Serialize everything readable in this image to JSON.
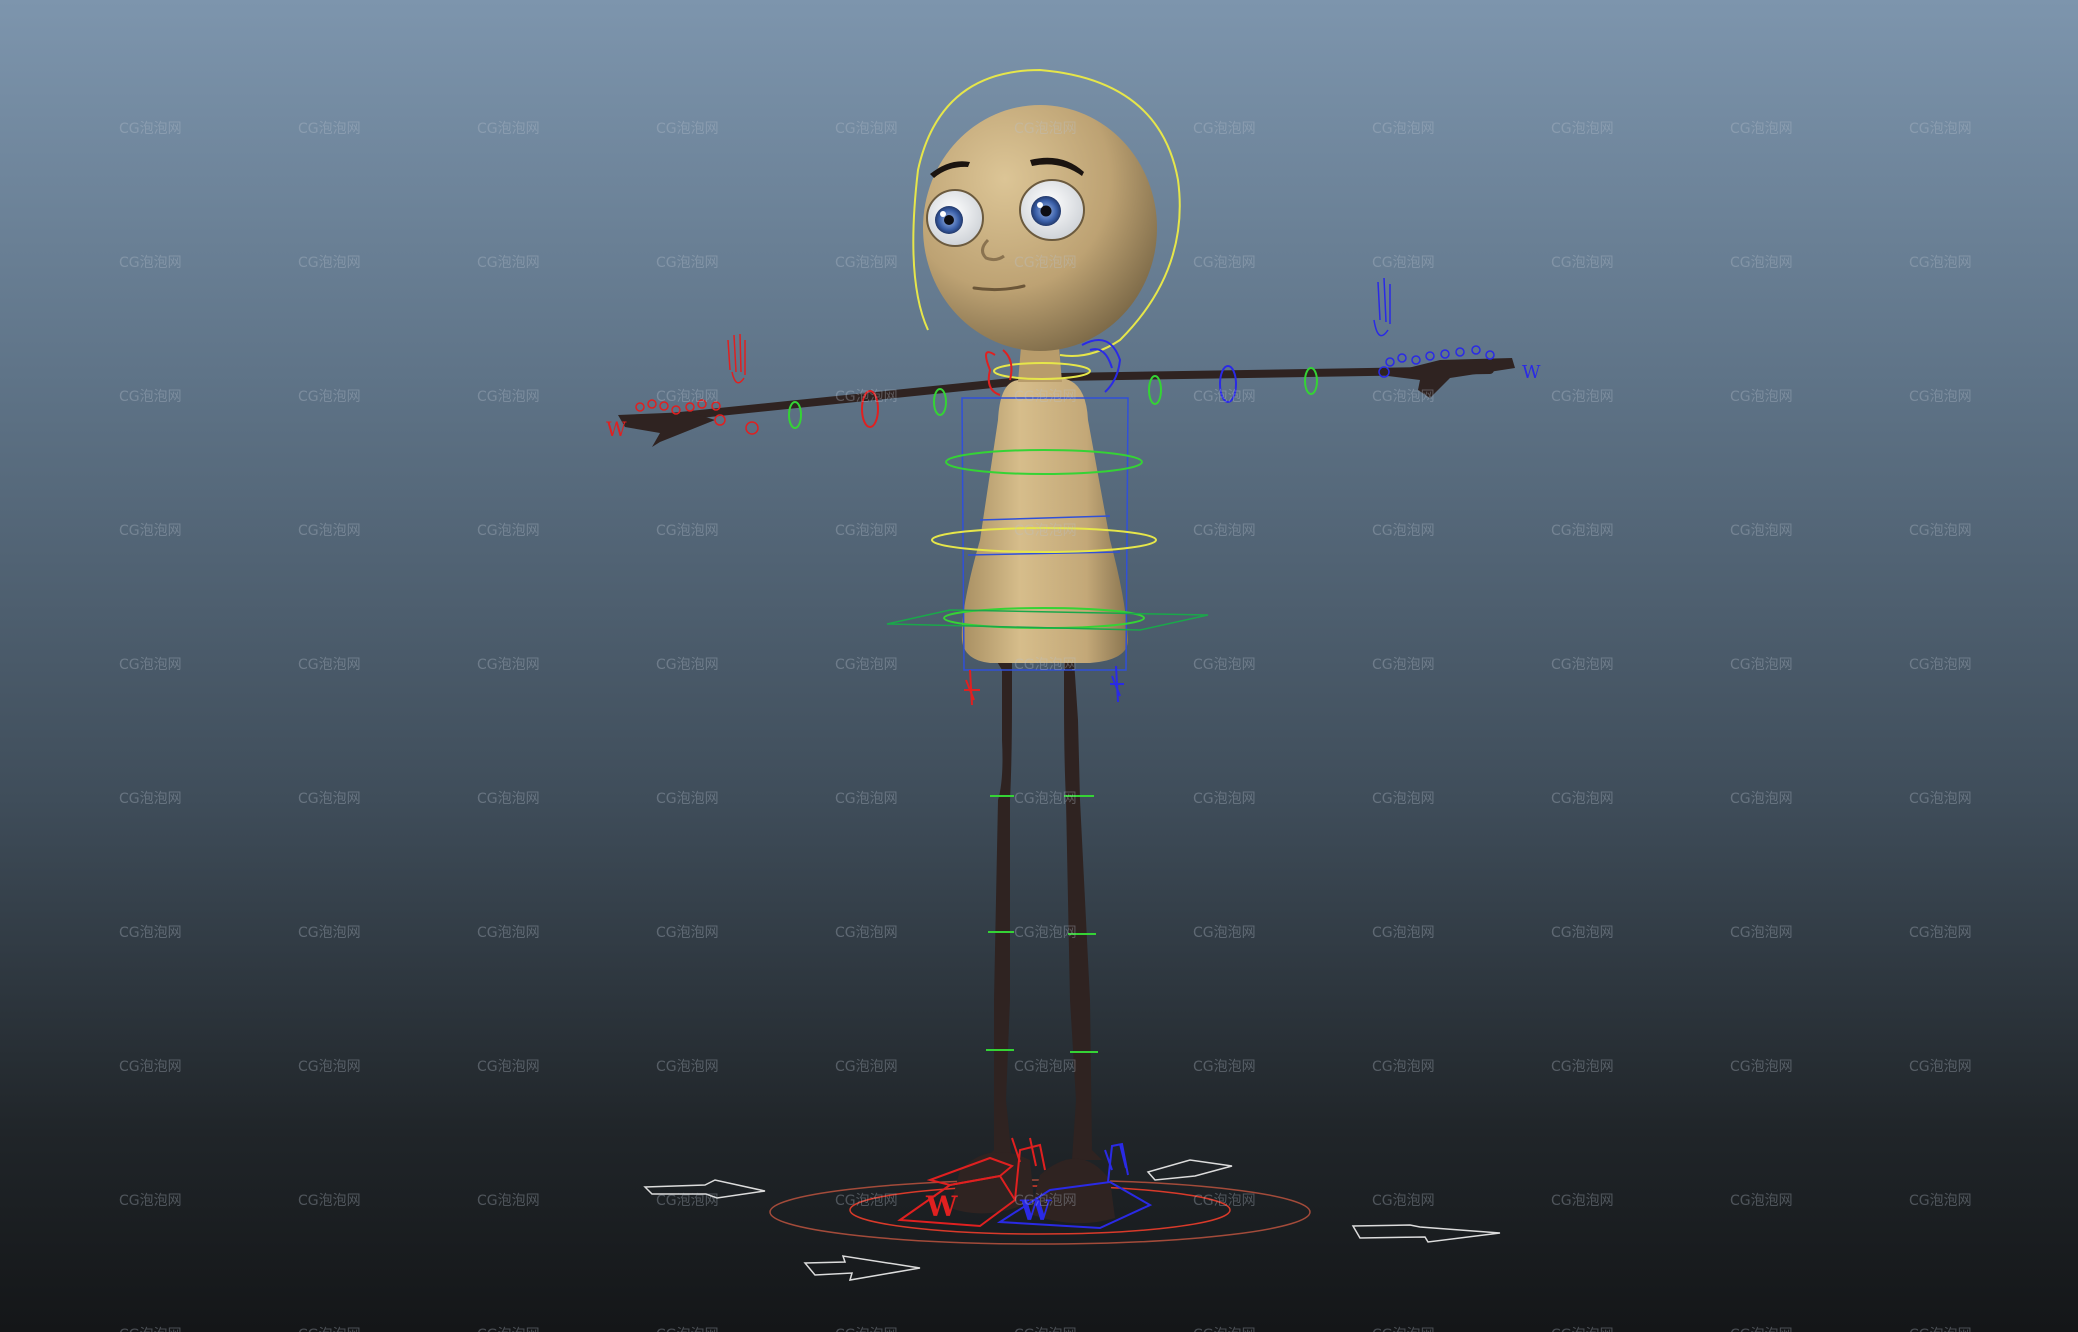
{
  "viewport": {
    "name": "3D perspective viewport",
    "background_top": "#7d95ad",
    "background_bottom": "#141618"
  },
  "character": {
    "description": "Rigged cartoon character in T-pose",
    "skin_color": "#c9ae7c",
    "limb_color": "#2f2321",
    "iris_color": "#3a5fa8"
  },
  "controls": {
    "head_curve_color": "#e6e64a",
    "fk_ring_color": "#35d335",
    "left_side_color": "#e02020",
    "right_side_color": "#2a2ae6",
    "bounding_box_color": "#3050d8",
    "ground_arrow_color": "#dcdcdc",
    "ik_left_label": "W",
    "ik_right_label": "W",
    "hand_left_label": "W",
    "hand_right_label": "W"
  },
  "watermark": {
    "text": "CG泡泡网"
  }
}
